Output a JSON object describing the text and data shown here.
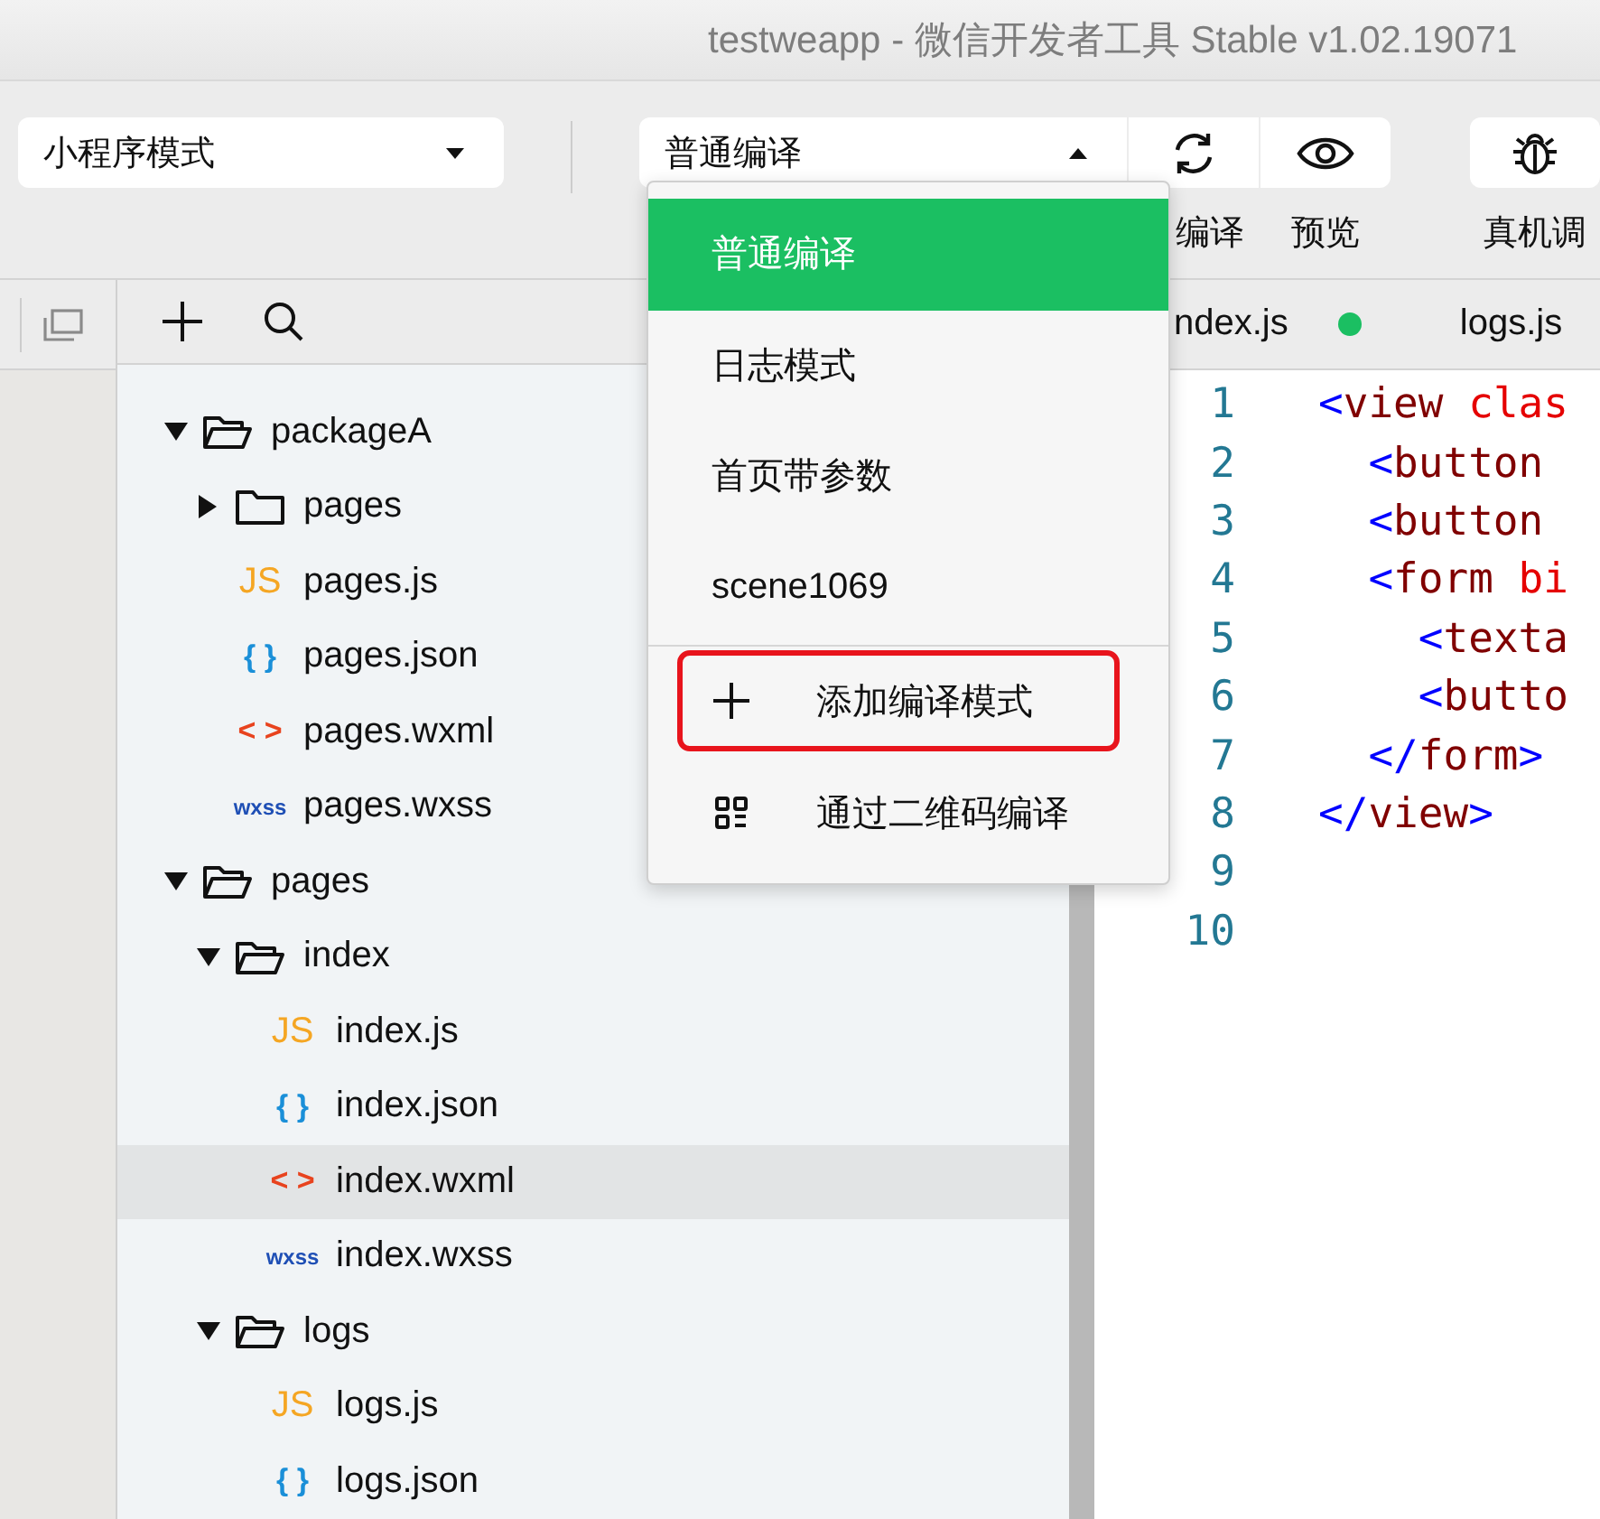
{
  "window": {
    "title": "testweapp - 微信开发者工具 Stable v1.02.19071"
  },
  "toolbar": {
    "mode_select": {
      "value": "小程序模式",
      "open": false
    },
    "compile_select": {
      "value": "普通编译",
      "open": true
    },
    "buttons": [
      {
        "kind": "compile",
        "label": "编译"
      },
      {
        "kind": "preview",
        "label": "预览"
      },
      {
        "kind": "device-debug",
        "label": "真机调"
      }
    ]
  },
  "compile_menu": {
    "modes": [
      {
        "label": "普通编译",
        "selected": true
      },
      {
        "label": "日志模式",
        "selected": false
      },
      {
        "label": "首页带参数",
        "selected": false
      },
      {
        "label": "scene1069",
        "selected": false
      }
    ],
    "actions": [
      {
        "kind": "add",
        "label": "添加编译模式",
        "outlined": true
      },
      {
        "kind": "qrcode",
        "label": "通过二维码编译",
        "outlined": false
      }
    ]
  },
  "file_tree": [
    {
      "kind": "folder",
      "name": "packageA",
      "expanded": true,
      "selected": false,
      "children": [
        {
          "kind": "folder",
          "name": "pages",
          "expanded": false,
          "selected": false
        },
        {
          "kind": "js",
          "icon": "JS",
          "name": "pages.js",
          "selected": false
        },
        {
          "kind": "json",
          "icon": "{ }",
          "name": "pages.json",
          "selected": false
        },
        {
          "kind": "wxml",
          "icon": "< >",
          "name": "pages.wxml",
          "selected": false
        },
        {
          "kind": "wxss",
          "icon": "wxss",
          "name": "pages.wxss",
          "selected": false
        }
      ]
    },
    {
      "kind": "folder",
      "name": "pages",
      "expanded": true,
      "selected": false,
      "children": [
        {
          "kind": "folder",
          "name": "index",
          "expanded": true,
          "selected": false,
          "children": [
            {
              "kind": "js",
              "icon": "JS",
              "name": "index.js",
              "selected": false
            },
            {
              "kind": "json",
              "icon": "{ }",
              "name": "index.json",
              "selected": false
            },
            {
              "kind": "wxml",
              "icon": "< >",
              "name": "index.wxml",
              "selected": true
            },
            {
              "kind": "wxss",
              "icon": "wxss",
              "name": "index.wxss",
              "selected": false
            }
          ]
        },
        {
          "kind": "folder",
          "name": "logs",
          "expanded": true,
          "selected": false,
          "children": [
            {
              "kind": "js",
              "icon": "JS",
              "name": "logs.js",
              "selected": false
            },
            {
              "kind": "json",
              "icon": "{ }",
              "name": "logs.json",
              "selected": false
            }
          ]
        }
      ]
    }
  ],
  "editor": {
    "tabs": [
      {
        "label": "ndex.js",
        "modified": true
      },
      {
        "label": "logs.js",
        "modified": false
      }
    ],
    "lines": [
      {
        "number": "1",
        "tokens": [
          {
            "kind": "bracket",
            "text": "<"
          },
          {
            "kind": "tag",
            "text": "view"
          },
          {
            "kind": "attr",
            "text": " clas"
          }
        ]
      },
      {
        "number": "2",
        "tokens": [
          {
            "kind": "bracket",
            "text": "  <"
          },
          {
            "kind": "tag",
            "text": "button"
          }
        ]
      },
      {
        "number": "3",
        "tokens": [
          {
            "kind": "bracket",
            "text": "  <"
          },
          {
            "kind": "tag",
            "text": "button"
          }
        ]
      },
      {
        "number": "4",
        "tokens": [
          {
            "kind": "bracket",
            "text": "  <"
          },
          {
            "kind": "tag",
            "text": "form"
          },
          {
            "kind": "attr",
            "text": " bi"
          }
        ]
      },
      {
        "number": "5",
        "tokens": [
          {
            "kind": "bracket",
            "text": "    <"
          },
          {
            "kind": "tag",
            "text": "texta"
          }
        ]
      },
      {
        "number": "6",
        "tokens": [
          {
            "kind": "bracket",
            "text": "    <"
          },
          {
            "kind": "tag",
            "text": "butto"
          }
        ]
      },
      {
        "number": "7",
        "tokens": [
          {
            "kind": "bracket",
            "text": "  </"
          },
          {
            "kind": "tag",
            "text": "form"
          },
          {
            "kind": "bracket",
            "text": ">"
          }
        ]
      },
      {
        "number": "8",
        "tokens": [
          {
            "kind": "bracket",
            "text": "</"
          },
          {
            "kind": "tag",
            "text": "view"
          },
          {
            "kind": "bracket",
            "text": ">"
          }
        ]
      },
      {
        "number": "9"
      },
      {
        "number": "10"
      }
    ]
  }
}
